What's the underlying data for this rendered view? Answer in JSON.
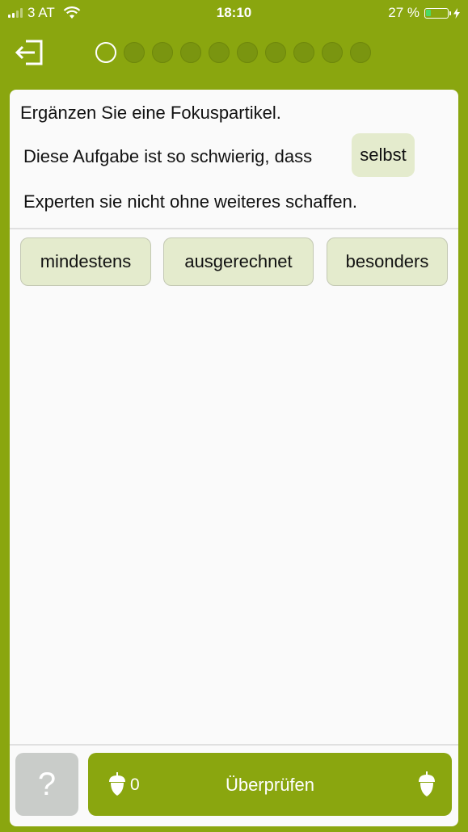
{
  "status_bar": {
    "carrier": "3 AT",
    "time": "18:10",
    "battery": "27 %",
    "battery_level": 0.27
  },
  "progress": {
    "total": 10,
    "current": 1
  },
  "exercise": {
    "instruction": "Ergänzen Sie eine Fokuspartikel.",
    "sentence_line1": "Diese Aufgabe ist so schwierig, dass",
    "gap_answer": "selbst",
    "sentence_line2": "Experten sie nicht ohne weiteres schaffen."
  },
  "options": [
    "mindestens",
    "ausgerechnet",
    "besonders"
  ],
  "footer": {
    "help_label": "?",
    "check_label": "Überprüfen",
    "acorn_count": "0"
  },
  "colors": {
    "brand_green": "#8aa60f",
    "chip_bg": "#e4ebcd",
    "help_gray": "#c9ccc9"
  },
  "icons": {
    "exit": "exit-icon",
    "acorn": "acorn-icon",
    "wifi": "wifi-icon",
    "battery": "battery-icon",
    "charging": "charging-bolt-icon"
  }
}
